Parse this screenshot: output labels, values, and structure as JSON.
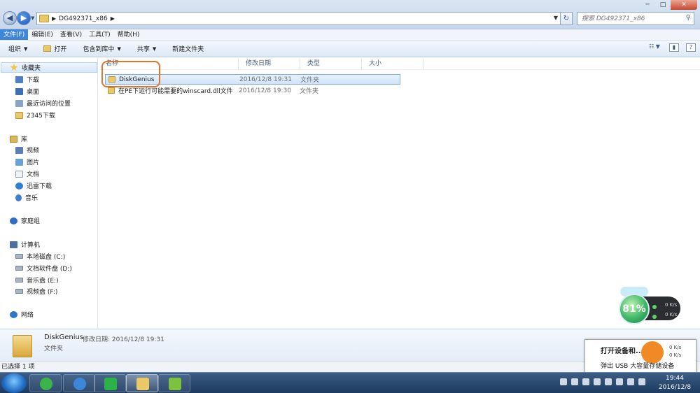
{
  "address": {
    "path": "DG492371_x86",
    "search_placeholder": "搜索 DG492371_x86",
    "back_label": "◀",
    "forward_label": "▶",
    "refresh_label": "↻",
    "search_icon": "magnifier-icon"
  },
  "window_controls": {
    "minimize": "─",
    "maximize": "□",
    "close": "✕"
  },
  "menu": [
    {
      "label": "文件(F)",
      "active": true
    },
    {
      "label": "编辑(E)"
    },
    {
      "label": "查看(V)"
    },
    {
      "label": "工具(T)"
    },
    {
      "label": "帮助(H)"
    }
  ],
  "toolbar": {
    "organize": "组织",
    "open": "打开",
    "include_library": "包含到库中",
    "share": "共享",
    "new_folder": "新建文件夹"
  },
  "nav": {
    "favorites": "收藏夹",
    "downloads": "下载",
    "desktop": "桌面",
    "recent": "最近访问的位置",
    "dl2345": "2345下载",
    "libraries": "库",
    "videos": "视频",
    "pictures": "图片",
    "documents": "文档",
    "xunlei": "迅雷下载",
    "music": "音乐",
    "homegroup": "家庭组",
    "computer": "计算机",
    "drive_c": "本地磁盘 (C:)",
    "drive_d": "文档软件盘 (D:)",
    "drive_e": "音乐盘 (E:)",
    "drive_f": "视频盘 (F:)",
    "network": "网络"
  },
  "columns": {
    "name": "名称",
    "date": "修改日期",
    "type": "类型",
    "size": "大小"
  },
  "files": [
    {
      "name": "DiskGenius",
      "date": "2016/12/8 19:31",
      "type": "文件夹",
      "selected": true
    },
    {
      "name": "在PE下运行可能需要的winscard.dll文件",
      "date": "2016/12/8 19:30",
      "type": "文件夹",
      "selected": false
    }
  ],
  "details": {
    "name": "DiskGenius",
    "meta_label": "修改日期:",
    "meta_value": "2016/12/8 19:31",
    "type": "文件夹"
  },
  "status": {
    "text": "已选择 1 项"
  },
  "widget": {
    "percent": "81%",
    "up": "0 K/s",
    "down": "0 K/s"
  },
  "popup": {
    "title": "打开设备和...",
    "subtitle": "弹出 USB 大容量存储设备",
    "rate1": "0 K/s",
    "rate2": "0 K/s"
  },
  "taskbar": {
    "time": "19:44",
    "date": "2016/12/8"
  },
  "colors": {
    "accent": "#3d86d9",
    "highlight_ring": "#e1732b",
    "folder": "#e9c86a",
    "taskbar": "#1d3a5f"
  }
}
